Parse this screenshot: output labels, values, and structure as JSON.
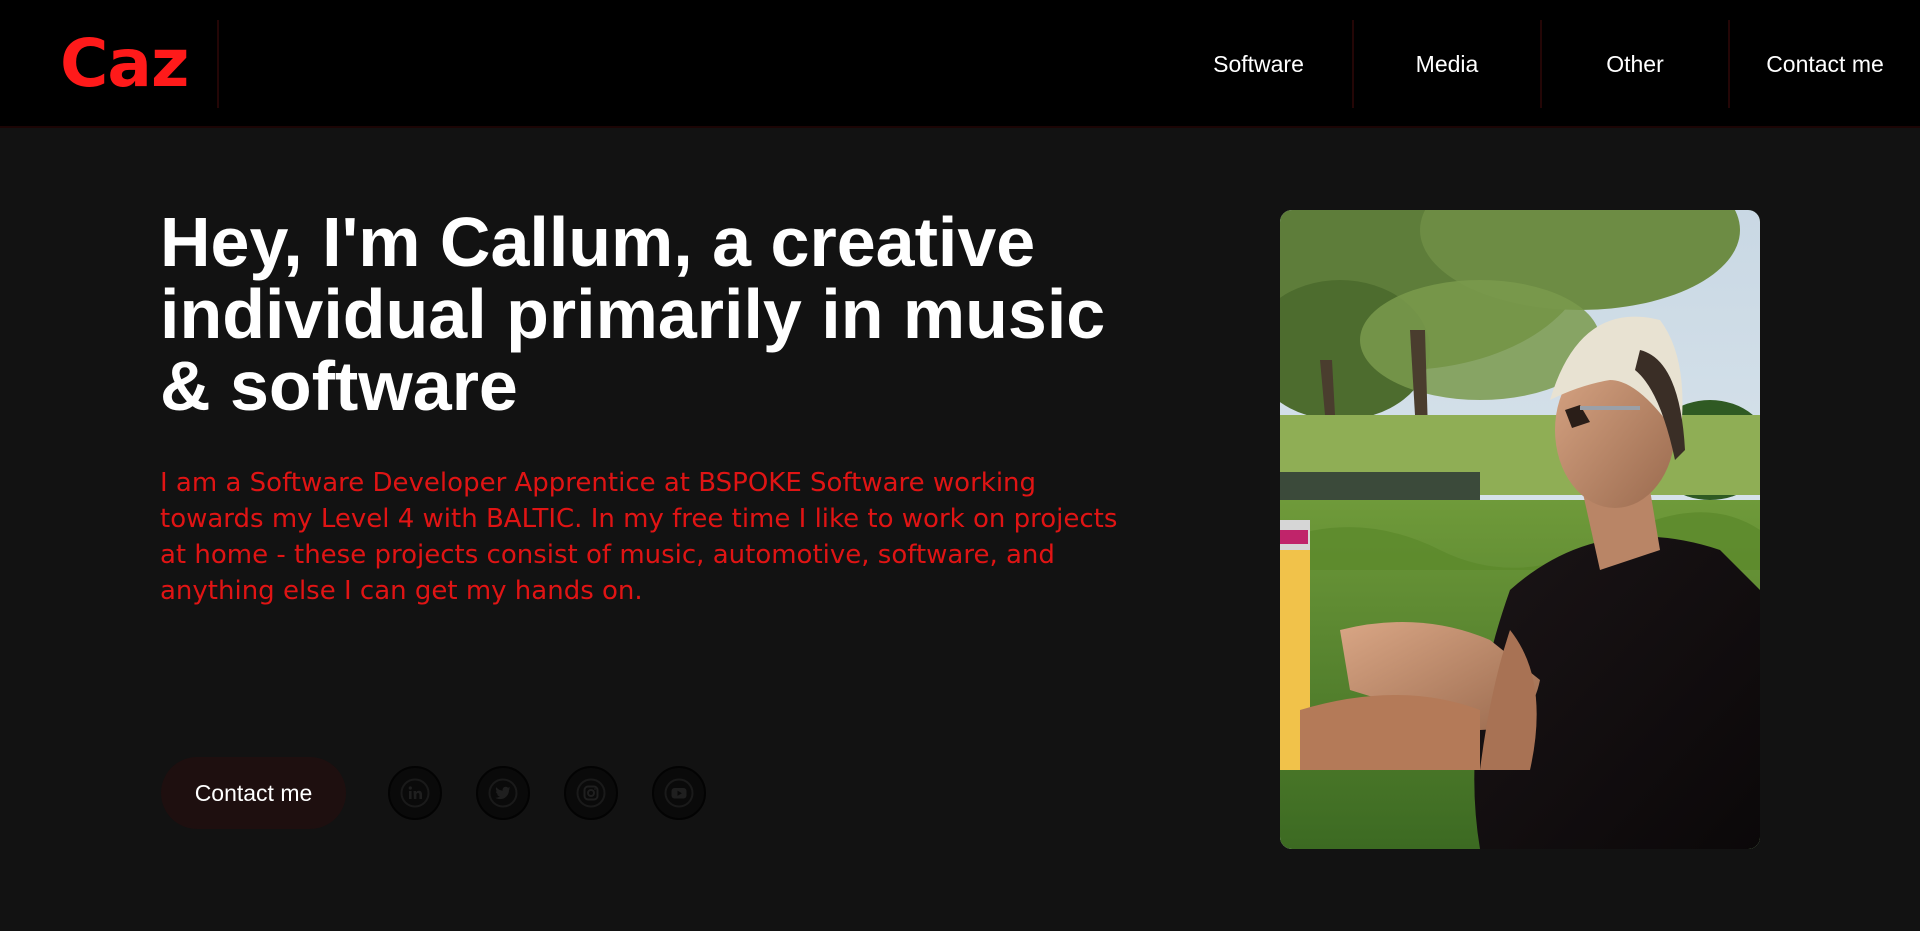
{
  "header": {
    "logo": "Caz",
    "nav": [
      "Software",
      "Media",
      "Other",
      "Contact me"
    ]
  },
  "hero": {
    "headline": "Hey, I'm Callum, a creative individual primarily in music & software",
    "intro": "I am a Software Developer Apprentice at BSPOKE Software working towards my Level 4 with BALTIC. In my free time I like to work on projects at home - these projects consist of music, automotive, software, and anything else I can get my hands on.",
    "contact_button": "Contact me",
    "socials": [
      "linkedin-icon",
      "twitter-icon",
      "instagram-icon",
      "youtube-icon"
    ]
  },
  "colors": {
    "accent": "#ff1a1a",
    "intro_text": "#e01414",
    "background": "#121212",
    "header": "#000000"
  }
}
